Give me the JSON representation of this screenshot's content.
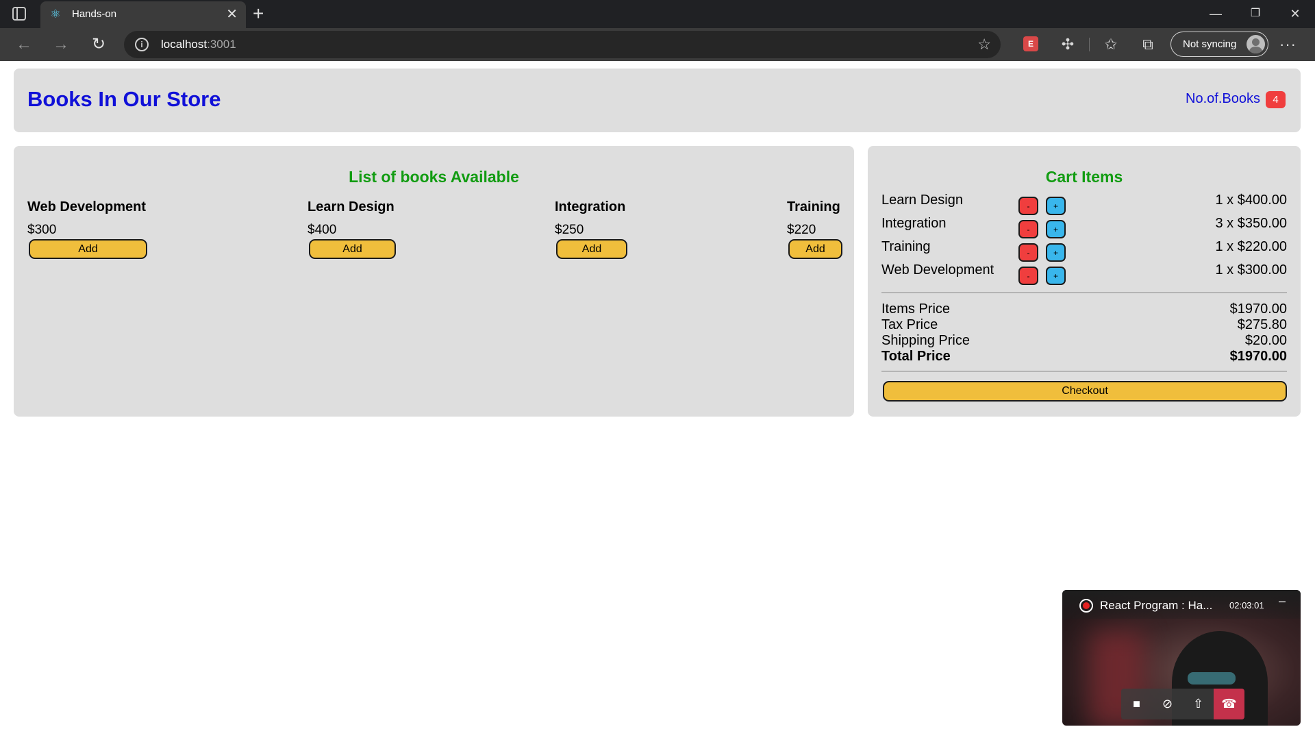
{
  "browser": {
    "tab_title": "Hands-on",
    "new_tab": "+",
    "tab_close": "✕",
    "url_host": "localhost",
    "url_port": ":3001",
    "sync_label": "Not syncing",
    "more": "···",
    "ext_badge": "E"
  },
  "header": {
    "title": "Books In Our Store",
    "count_label": "No.of.Books",
    "count_value": "4"
  },
  "books_panel": {
    "heading": "List of books Available",
    "add_label": "Add",
    "books": [
      {
        "title": "Web Development",
        "price": "$300"
      },
      {
        "title": "Learn Design",
        "price": "$400"
      },
      {
        "title": "Integration",
        "price": "$250"
      },
      {
        "title": "Training",
        "price": "$220"
      }
    ]
  },
  "cart": {
    "heading": "Cart Items",
    "minus_label": "-",
    "plus_label": "+",
    "items": [
      {
        "name": "Learn Design",
        "amount": "1 x $400.00"
      },
      {
        "name": "Integration",
        "amount": "3 x $350.00"
      },
      {
        "name": "Training",
        "amount": "1 x $220.00"
      },
      {
        "name": "Web Development",
        "amount": "1 x $300.00"
      }
    ],
    "summary": {
      "items_label": "Items Price",
      "items_value": "$1970.00",
      "tax_label": "Tax Price",
      "tax_value": "$275.80",
      "shipping_label": "Shipping Price",
      "shipping_value": "$20.00",
      "total_label": "Total Price",
      "total_value": "$1970.00"
    },
    "checkout_label": "Checkout"
  },
  "call": {
    "title": "React Program : Ha...",
    "time": "02:03:01"
  },
  "colors": {
    "title_blue": "#1010d8",
    "heading_green": "#129c12",
    "button_yellow": "#f0be3c",
    "badge_red": "#f03e3e",
    "plus_blue": "#39b6ec",
    "panel_gray": "#dedede"
  },
  "icons": {
    "tab_actions": "tab-actions-icon",
    "favicon": "react-icon",
    "back": "back-arrow-icon",
    "forward": "forward-arrow-icon",
    "refresh": "refresh-icon",
    "site_info": "info-icon",
    "add_favorite": "star-plus-icon",
    "extensions": "puzzle-icon",
    "favorites": "favorites-icon",
    "collections": "collections-icon",
    "profile": "avatar-icon",
    "record": "record-icon",
    "camera": "camera-icon",
    "mute": "mic-off-icon",
    "share": "share-screen-icon",
    "hangup": "hangup-icon"
  }
}
